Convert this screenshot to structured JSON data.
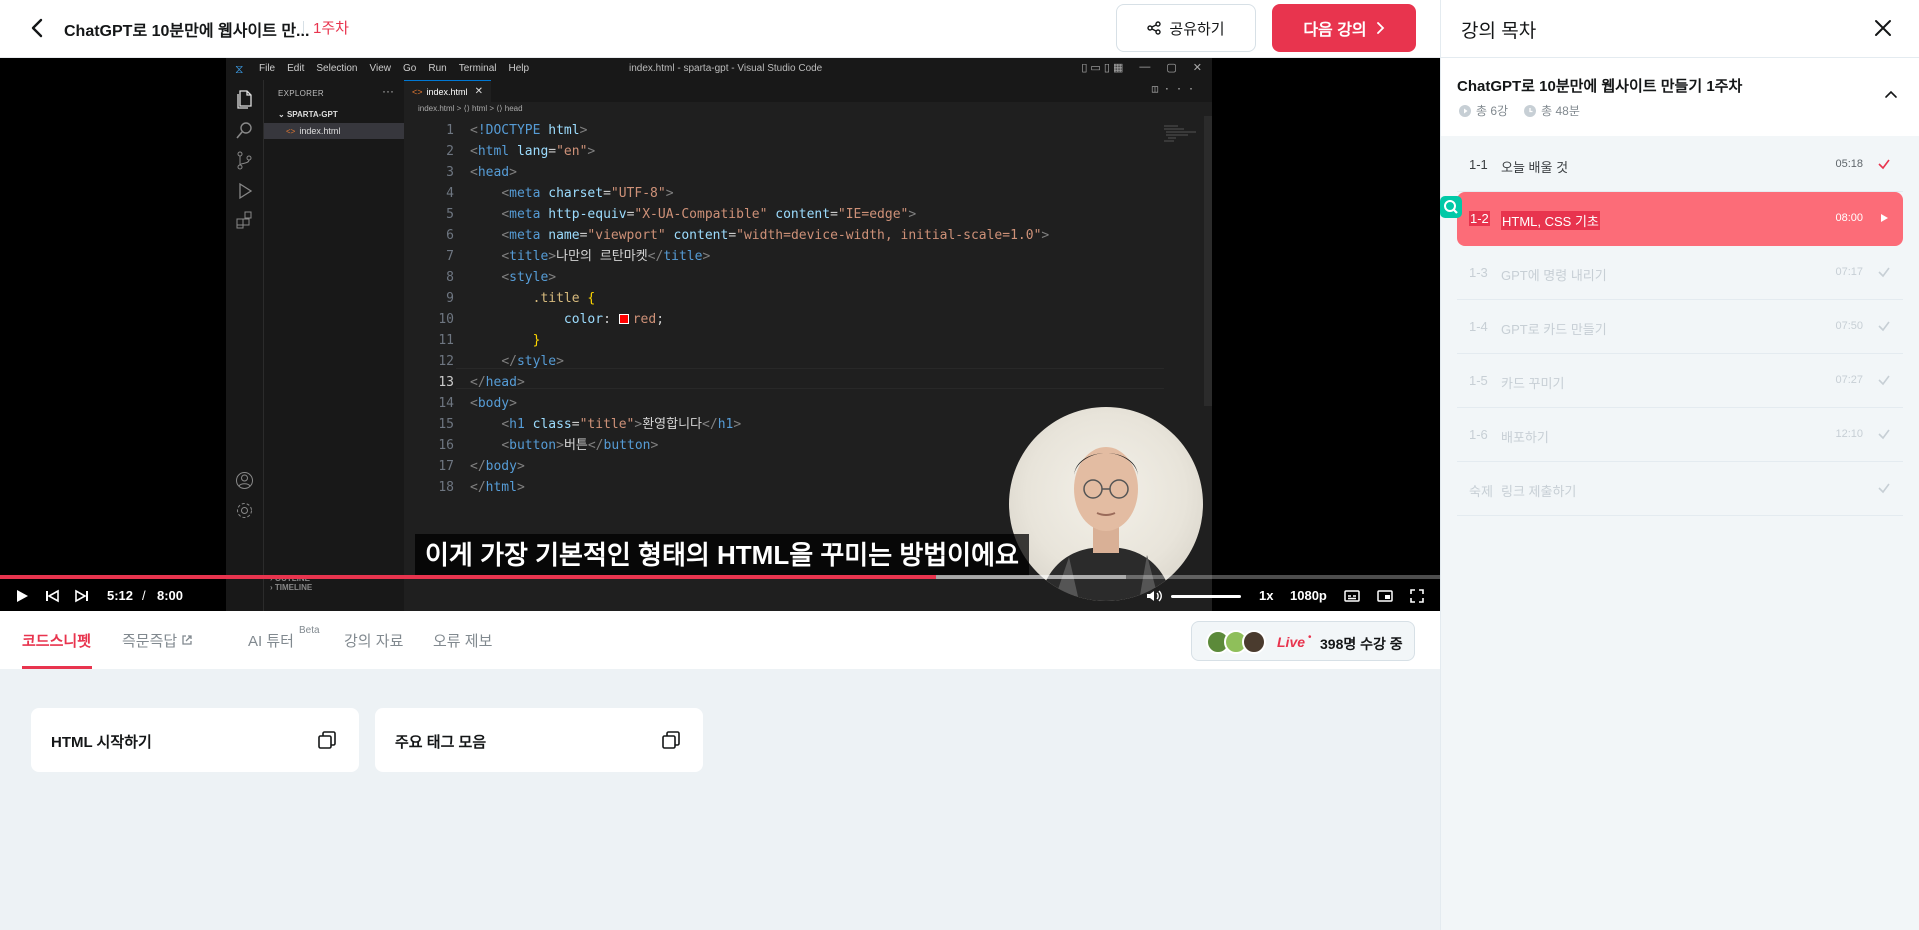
{
  "header": {
    "course_title": "ChatGPT로 10분만에 웹사이트 만...",
    "week_badge": "1주차",
    "share_label": "공유하기",
    "next_label": "다음 강의"
  },
  "vscode": {
    "menu": [
      "File",
      "Edit",
      "Selection",
      "View",
      "Go",
      "Run",
      "Terminal",
      "Help"
    ],
    "window_title": "index.html - sparta-gpt - Visual Studio Code",
    "explorer_label": "EXPLORER",
    "folder_name": "SPARTA-GPT",
    "file_name": "index.html",
    "tab_name": "index.html",
    "breadcrumb": "index.html > ⟨⟩ html > ⟨⟩ head",
    "outline_label": "OUTLINE",
    "timeline_label": "TIMELINE",
    "active_line": 13
  },
  "code_lines": [
    {
      "n": "1",
      "html": "<span class='t-pun'>&lt;</span><span class='t-tag'>!DOCTYPE</span> <span class='t-attr'>html</span><span class='t-pun'>&gt;</span>"
    },
    {
      "n": "2",
      "html": "<span class='t-pun'>&lt;</span><span class='t-tag'>html</span> <span class='t-attr'>lang</span>=<span class='t-str'>\"en\"</span><span class='t-pun'>&gt;</span>"
    },
    {
      "n": "3",
      "html": "<span class='t-pun'>&lt;</span><span class='t-tag'>head</span><span class='t-pun'>&gt;</span>"
    },
    {
      "n": "4",
      "html": "    <span class='t-pun'>&lt;</span><span class='t-tag'>meta</span> <span class='t-attr'>charset</span>=<span class='t-str'>\"UTF-8\"</span><span class='t-pun'>&gt;</span>"
    },
    {
      "n": "5",
      "html": "    <span class='t-pun'>&lt;</span><span class='t-tag'>meta</span> <span class='t-attr'>http-equiv</span>=<span class='t-str'>\"X-UA-Compatible\"</span> <span class='t-attr'>content</span>=<span class='t-str'>\"IE=edge\"</span><span class='t-pun'>&gt;</span>"
    },
    {
      "n": "6",
      "html": "    <span class='t-pun'>&lt;</span><span class='t-tag'>meta</span> <span class='t-attr'>name</span>=<span class='t-str'>\"viewport\"</span> <span class='t-attr'>content</span>=<span class='t-str'>\"width=device-width, initial-scale=1.0\"</span><span class='t-pun'>&gt;</span>"
    },
    {
      "n": "7",
      "html": "    <span class='t-pun'>&lt;</span><span class='t-tag'>title</span><span class='t-pun'>&gt;</span><span class='t-text'>나만의 르탄마켓</span><span class='t-pun'>&lt;/</span><span class='t-tag'>title</span><span class='t-pun'>&gt;</span>"
    },
    {
      "n": "8",
      "html": "    <span class='t-pun'>&lt;</span><span class='t-tag'>style</span><span class='t-pun'>&gt;</span>"
    },
    {
      "n": "9",
      "html": "        <span class='t-sel'>.title</span> <span class='t-brace'>{</span>"
    },
    {
      "n": "10",
      "html": "            <span class='t-prop'>color</span>: <span class='swatch'></span><span class='t-str'>red</span>;"
    },
    {
      "n": "11",
      "html": "        <span class='t-brace'>}</span>"
    },
    {
      "n": "12",
      "html": "    <span class='t-pun'>&lt;/</span><span class='t-tag'>style</span><span class='t-pun'>&gt;</span>"
    },
    {
      "n": "13",
      "html": "<span class='t-pun'>&lt;/</span><span class='t-tag'>head</span><span class='t-pun'>&gt;</span>"
    },
    {
      "n": "14",
      "html": "<span class='t-pun'>&lt;</span><span class='t-tag'>body</span><span class='t-pun'>&gt;</span>"
    },
    {
      "n": "15",
      "html": "    <span class='t-pun'>&lt;</span><span class='t-tag'>h1</span> <span class='t-attr'>class</span>=<span class='t-str'>\"title\"</span><span class='t-pun'>&gt;</span><span class='t-text'>환영합니다</span><span class='t-pun'>&lt;/</span><span class='t-tag'>h1</span><span class='t-pun'>&gt;</span>"
    },
    {
      "n": "16",
      "html": "    <span class='t-pun'>&lt;</span><span class='t-tag'>button</span><span class='t-pun'>&gt;</span><span class='t-text'>버튼</span><span class='t-pun'>&lt;/</span><span class='t-tag'>button</span><span class='t-pun'>&gt;</span>"
    },
    {
      "n": "17",
      "html": "<span class='t-pun'>&lt;/</span><span class='t-tag'>body</span><span class='t-pun'>&gt;</span>"
    },
    {
      "n": "18",
      "html": "<span class='t-pun'>&lt;/</span><span class='t-tag'>html</span><span class='t-pun'>&gt;</span>"
    }
  ],
  "video": {
    "subtitle": "이게 가장 기본적인 형태의 HTML을 꾸미는 방법이에요",
    "current_time": "5:12",
    "time_separator": "/",
    "duration": "8:00",
    "progress": 0.65,
    "speed": "1x",
    "quality": "1080p",
    "volume": 1.0
  },
  "tabs": {
    "items": [
      "코드스니펫",
      "즉문즉답",
      "AI 튜터",
      "강의 자료",
      "오류 제보"
    ],
    "beta": "Beta",
    "live_label": "Live",
    "live_count": "398명 수강 중"
  },
  "snippets": [
    "HTML 시작하기",
    "주요 태그 모음"
  ],
  "panel": {
    "title": "강의 목차",
    "course_title": "ChatGPT로 10분만에 웹사이트 만들기 1주차",
    "lesson_count": "총 6강",
    "total_time": "총 48분",
    "lessons": [
      {
        "num": "1-1",
        "name": "오늘 배울 것",
        "dur": "05:18",
        "state": "done"
      },
      {
        "num": "1-2",
        "name": "HTML, CSS 기초",
        "dur": "08:00",
        "state": "playing"
      },
      {
        "num": "1-3",
        "name": "GPT에 명령 내리기",
        "dur": "07:17",
        "state": "todo"
      },
      {
        "num": "1-4",
        "name": "GPT로 카드 만들기",
        "dur": "07:50",
        "state": "todo"
      },
      {
        "num": "1-5",
        "name": "카드 꾸미기",
        "dur": "07:27",
        "state": "todo"
      },
      {
        "num": "1-6",
        "name": "배포하기",
        "dur": "12:10",
        "state": "todo"
      },
      {
        "num": "숙제",
        "name": "링크 제출하기",
        "dur": "",
        "state": "todo"
      }
    ]
  },
  "colors": {
    "accent": "#e8344e",
    "active_row": "#fc6c78",
    "done_check": "#e8344e"
  }
}
